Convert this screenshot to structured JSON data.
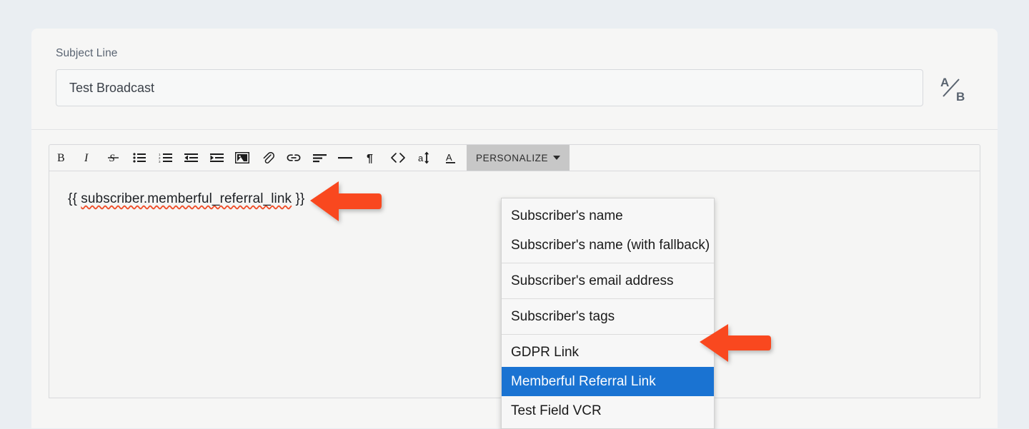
{
  "theme": {
    "page_background": "#eaeef2",
    "card_background": "#f6f6f5",
    "accent_blue": "#1a73d2",
    "arrow_orange": "#f9481f",
    "spellcheck_underline": "#ef4d28",
    "toolbar_active_background": "#c7c7c7"
  },
  "subject": {
    "label": "Subject Line",
    "value": "Test Broadcast",
    "placeholder": "Subject Line",
    "ab_test_top_label": "A",
    "ab_test_bottom_label": "B",
    "ab_icon_name": "ab-split-test-icon"
  },
  "toolbar": {
    "buttons": [
      {
        "name": "bold-icon",
        "label": "B"
      },
      {
        "name": "italic-icon",
        "label": "I"
      },
      {
        "name": "strikethrough-icon",
        "label": "S"
      },
      {
        "name": "bullet-list-icon",
        "label": "Bulleted list"
      },
      {
        "name": "numbered-list-icon",
        "label": "Numbered list"
      },
      {
        "name": "outdent-icon",
        "label": "Decrease indent"
      },
      {
        "name": "indent-icon",
        "label": "Increase indent"
      },
      {
        "name": "image-icon",
        "label": "Insert image"
      },
      {
        "name": "paperclip-icon",
        "label": "Attach file"
      },
      {
        "name": "link-icon",
        "label": "Insert link"
      },
      {
        "name": "align-icon",
        "label": "Align"
      },
      {
        "name": "horizontal-rule-icon",
        "label": "Horizontal rule"
      },
      {
        "name": "pilcrow-icon",
        "label": "¶"
      },
      {
        "name": "code-icon",
        "label": "<>"
      },
      {
        "name": "font-size-icon",
        "label": "a"
      },
      {
        "name": "text-color-icon",
        "label": "A"
      }
    ],
    "personalize_label": "PERSONALIZE",
    "personalize_expanded": true
  },
  "editor": {
    "content_prefix": "{{ ",
    "content_token": "subscriber.memberful_referral_link",
    "content_suffix": " }}",
    "spellcheck_flagged": true
  },
  "personalize_menu": {
    "groups": [
      {
        "items": [
          {
            "label": "Subscriber's name",
            "selected": false
          },
          {
            "label": "Subscriber's name (with fallback)",
            "selected": false
          }
        ]
      },
      {
        "items": [
          {
            "label": "Subscriber's email address",
            "selected": false
          }
        ]
      },
      {
        "items": [
          {
            "label": "Subscriber's tags",
            "selected": false
          }
        ]
      },
      {
        "items": [
          {
            "label": "GDPR Link",
            "selected": false
          },
          {
            "label": "Memberful Referral Link",
            "selected": true
          },
          {
            "label": "Test Field VCR",
            "selected": false
          }
        ]
      }
    ]
  },
  "annotations": [
    {
      "name": "arrow-pointing-at-editor-token",
      "direction": "left",
      "color": "#f9481f"
    },
    {
      "name": "arrow-pointing-at-selected-menu-item",
      "direction": "left",
      "color": "#f9481f"
    }
  ]
}
